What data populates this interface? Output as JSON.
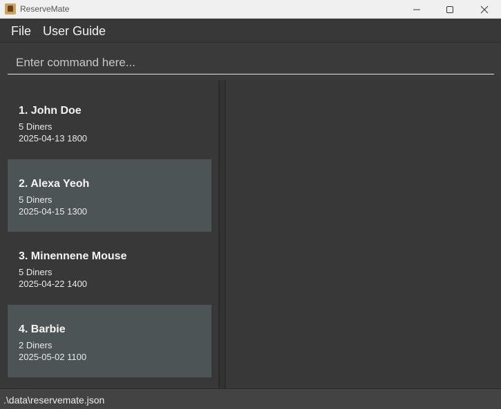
{
  "window": {
    "title": "ReserveMate",
    "icon": "app-logo-icon",
    "controls": [
      "minimize-icon",
      "maximize-icon",
      "close-icon"
    ]
  },
  "menu": {
    "file_label": "File",
    "guide_label": "User Guide"
  },
  "command": {
    "value": "",
    "placeholder": "Enter command here..."
  },
  "reservations": [
    {
      "name": "1. John Doe",
      "diners": "5 Diners",
      "datetime": "2025-04-13 1800"
    },
    {
      "name": "2. Alexa Yeoh",
      "diners": "5 Diners",
      "datetime": "2025-04-15 1300"
    },
    {
      "name": "3. Minennene Mouse",
      "diners": "5 Diners",
      "datetime": "2025-04-22 1400"
    },
    {
      "name": "4. Barbie",
      "diners": "2 Diners",
      "datetime": "2025-05-02 1100"
    }
  ],
  "status": {
    "path": ".\\data\\reservemate.json"
  },
  "colors": {
    "background": "#3a3a3a",
    "card_alternate": "#4d5456",
    "title_bar": "#f0f0f0"
  }
}
